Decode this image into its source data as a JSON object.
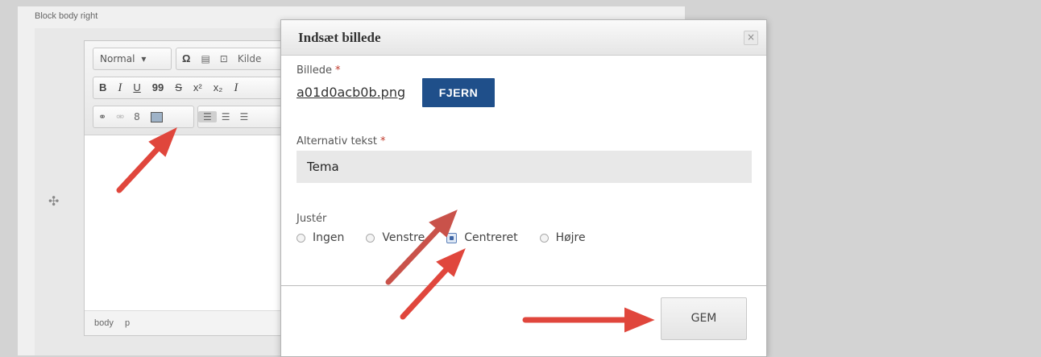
{
  "page": {
    "block_label": "Block body right"
  },
  "editor": {
    "format_select": "Normal",
    "source_label": "Kilde",
    "toolbar_row2": [
      "B",
      "I",
      "U",
      "”",
      "S",
      "x²",
      "x₂",
      "Iₓ"
    ],
    "statusbar": [
      "body",
      "p"
    ]
  },
  "dialog": {
    "title": "Indsæt billede",
    "close": "×",
    "image_label": "Billede",
    "required_mark": "*",
    "filename": "a01d0acb0b.png",
    "remove_label": "FJERN",
    "alt_label": "Alternativ tekst",
    "alt_value": "Tema",
    "align_label": "Justér",
    "align_options": [
      "Ingen",
      "Venstre",
      "Centreret",
      "Højre"
    ],
    "align_selected": "Centreret",
    "save_label": "GEM"
  },
  "colors": {
    "accent_button": "#1f4f8a",
    "annotation_arrow": "#e0463c",
    "required": "#c0392b"
  },
  "icons": [
    "move-icon",
    "omega-icon",
    "template-icon",
    "source-icon",
    "link-icon",
    "unlink-icon",
    "anchor-icon",
    "image-icon",
    "align-left-icon",
    "align-center-icon",
    "align-right-icon",
    "close-icon"
  ]
}
